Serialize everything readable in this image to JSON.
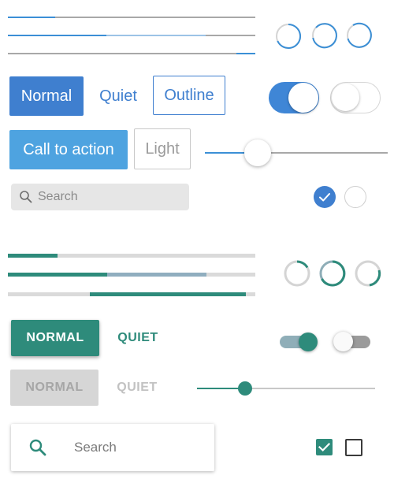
{
  "blue_theme": {
    "accent": "#3f7fcf",
    "progress_bars": [
      {
        "progress": 0.19
      },
      {
        "progress": 0.4,
        "buffer": 0.8
      },
      {
        "progress": 0.07,
        "align": "end"
      }
    ],
    "spinners": [
      "spinner-icon",
      "spinner-icon",
      "spinner-icon"
    ],
    "buttons": {
      "normal": "Normal",
      "quiet": "Quiet",
      "outline": "Outline",
      "call_to_action": "Call to action",
      "light": "Light"
    },
    "toggles": [
      {
        "state": "on"
      },
      {
        "state": "off"
      }
    ],
    "slider": {
      "value": 0.29
    },
    "search": {
      "placeholder": "Search",
      "icon": "search-icon"
    },
    "checkboxes": [
      {
        "checked": true
      },
      {
        "checked": false
      }
    ]
  },
  "teal_theme": {
    "accent": "#2e8b7b",
    "progress_bars": [
      {
        "progress": 0.2
      },
      {
        "progress": 0.4,
        "buffer": 0.8
      },
      {
        "progress": 0.63,
        "indeterminate_segment": true
      }
    ],
    "spinners": [
      "spinner-icon",
      "spinner-icon",
      "spinner-icon"
    ],
    "buttons": {
      "normal": "NORMAL",
      "quiet": "QUIET",
      "normal_disabled": "NORMAL",
      "quiet_disabled": "QUIET"
    },
    "toggles": [
      {
        "state": "on"
      },
      {
        "state": "off"
      }
    ],
    "slider": {
      "value": 0.27
    },
    "search": {
      "placeholder": "Search",
      "icon": "search-icon"
    },
    "checkboxes": [
      {
        "checked": true
      },
      {
        "checked": false
      }
    ]
  }
}
